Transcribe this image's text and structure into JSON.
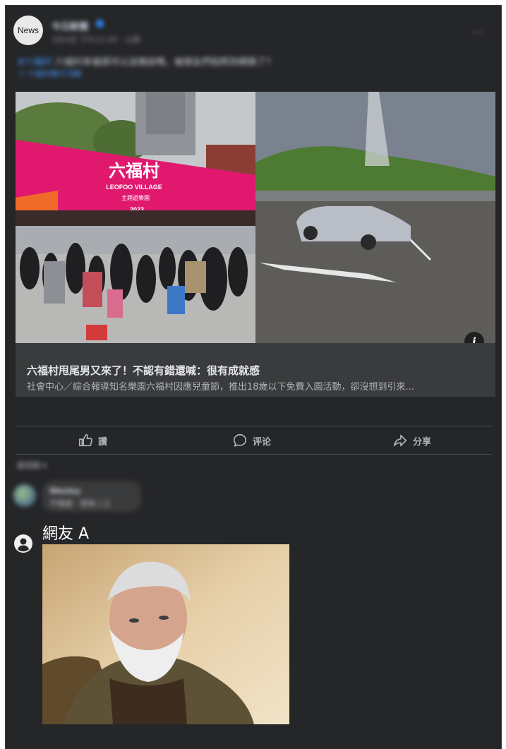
{
  "post": {
    "avatar_text": "News",
    "page_name": "今日新聞",
    "post_time": "3月4日 下午12:40 · 公開",
    "caption": "六福村幸福感可以這樣說嗎，被朋友們拍照到網路了?",
    "hashtag": "#六福村",
    "caption_link": "》六福村親子活動",
    "more_label": "···"
  },
  "link_preview": {
    "banner_title": "六福村",
    "banner_subtitle": "LEOFOO VILLAGE",
    "banner_tag": "主題遊樂園",
    "banner_year": "2023",
    "title": "六福村甩尾男又來了！不認有錯還喊：很有成就感",
    "description": "社會中心／綜合報導知名樂園六福村因應兒童節，推出18歲以下免費入園活動，卻沒想到引來...",
    "info_label": "i"
  },
  "actions": {
    "like_label": "讚",
    "comment_label": "评论",
    "share_label": "分享"
  },
  "comments": {
    "sort_label": "最相關 ▾",
    "first": {
      "author": "Wesley",
      "text": "不愧是 · 很有二三"
    },
    "reply_user": "網友 A"
  },
  "colors": {
    "card_bg": "#252628",
    "preview_bg": "#3a3b3c",
    "banner_pink": "#e0196f",
    "link_blue": "#4599ff"
  }
}
